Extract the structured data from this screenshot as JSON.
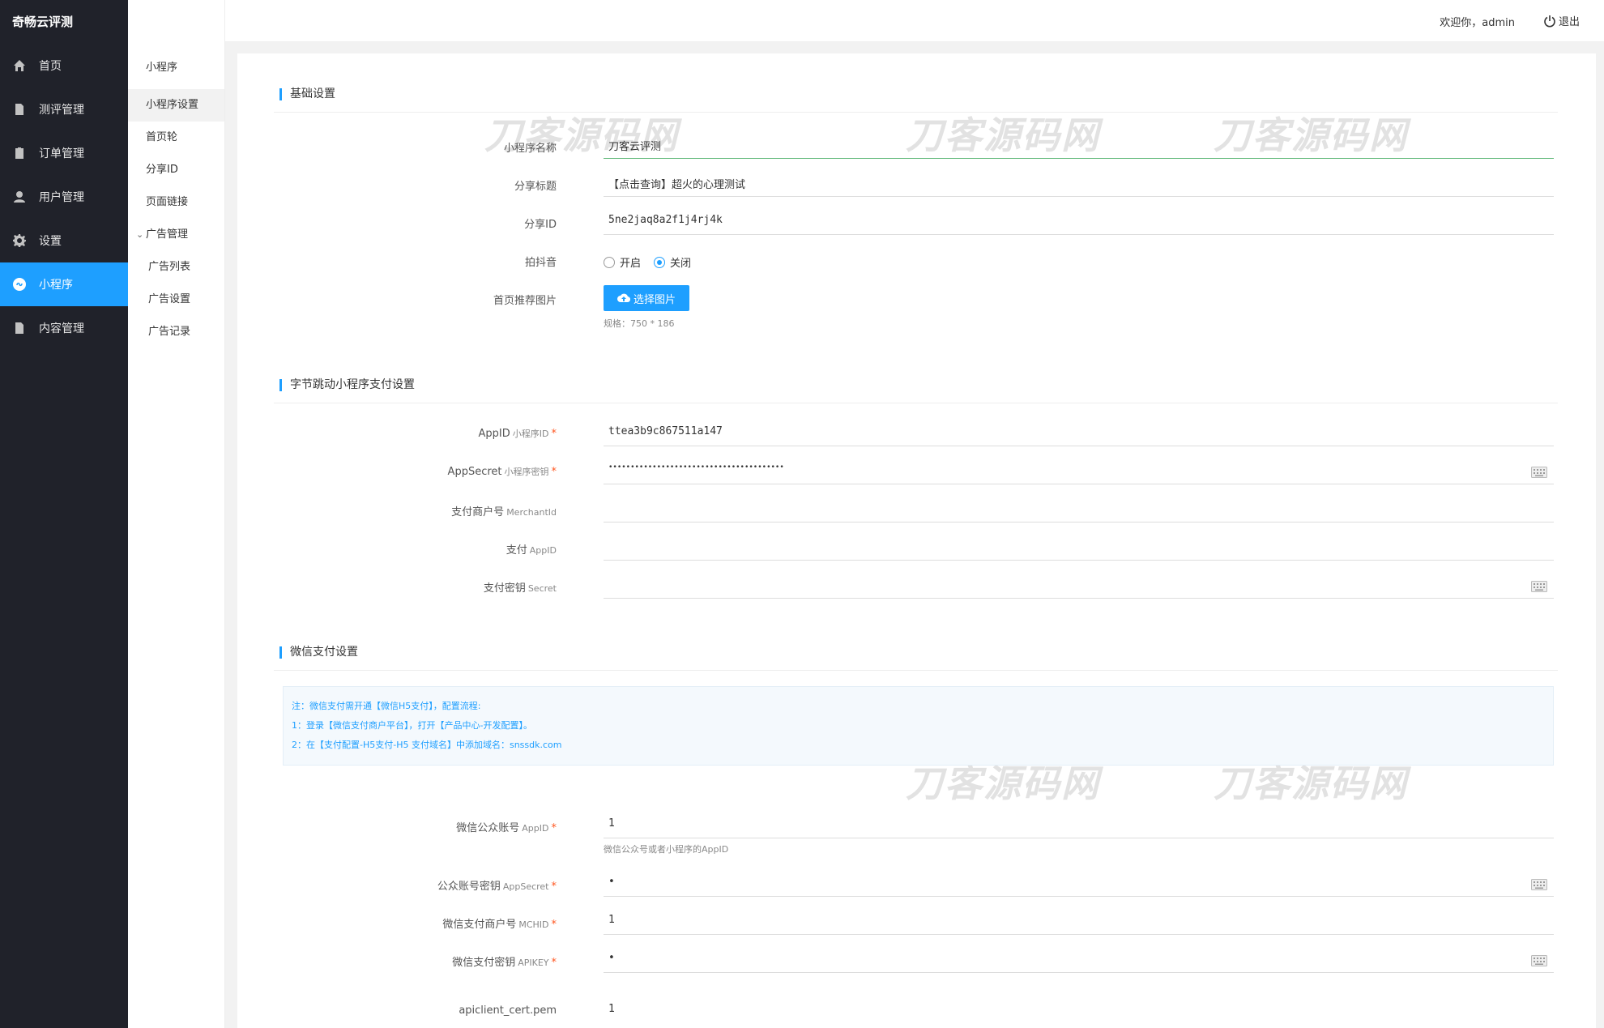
{
  "brand": "奇畅云评测",
  "nav": [
    {
      "label": "首页",
      "icon": "home-icon"
    },
    {
      "label": "测评管理",
      "icon": "document-icon"
    },
    {
      "label": "订单管理",
      "icon": "clipboard-icon"
    },
    {
      "label": "用户管理",
      "icon": "user-icon"
    },
    {
      "label": "设置",
      "icon": "gear-icon"
    },
    {
      "label": "小程序",
      "icon": "miniprogram-icon"
    },
    {
      "label": "内容管理",
      "icon": "document-icon"
    }
  ],
  "subnav": {
    "title": "小程序",
    "items": [
      "小程序设置",
      "首页轮",
      "分享ID",
      "页面链接"
    ],
    "group": "广告管理",
    "children": [
      "广告列表",
      "广告设置",
      "广告记录"
    ]
  },
  "header": {
    "welcome": "欢迎你，admin",
    "logout": "退出"
  },
  "watermark": "刀客源码网",
  "sections": {
    "basic": "基础设置",
    "bytedance": "字节跳动小程序支付设置",
    "wechat": "微信支付设置"
  },
  "basic": {
    "name_label": "小程序名称",
    "name_value": "刀客云评测",
    "share_title_label": "分享标题",
    "share_title_value": "【点击查询】超火的心理测试",
    "share_id_label": "分享ID",
    "share_id_value": "5ne2jaq8a2f1j4rj4k",
    "douyin_label": "拍抖音",
    "douyin_on": "开启",
    "douyin_off": "关闭",
    "douyin_selected": "关闭",
    "image_label": "首页推荐图片",
    "image_button": "选择图片",
    "image_hint": "规格：750 * 186"
  },
  "bytedance": {
    "appid_label": "AppID",
    "appid_sub": "小程序ID",
    "appid_value": "ttea3b9c867511a147",
    "secret_label": "AppSecret",
    "secret_sub": "小程序密钥",
    "secret_value": "••••••••••••••••••••••••••••••••••••••••",
    "merchant_label": "支付商户号",
    "merchant_sub": "MerchantId",
    "merchant_value": "",
    "pay_appid_label": "支付",
    "pay_appid_sub": "AppID",
    "pay_appid_value": "",
    "pay_secret_label": "支付密钥",
    "pay_secret_sub": "Secret",
    "pay_secret_value": ""
  },
  "notice": {
    "line1": "注：微信支付需开通【微信H5支付】，配置流程:",
    "line2": "1：登录【微信支付商户平台】，打开【产品中心-开发配置】。",
    "line3": "2：在【支付配置-H5支付-H5 支付域名】中添加域名：snssdk.com"
  },
  "wechat": {
    "appid_label": "微信公众账号",
    "appid_sub": "AppID",
    "appid_value": "1",
    "appid_hint": "微信公众号或者小程序的AppID",
    "secret_label": "公众账号密钥",
    "secret_sub": "AppSecret",
    "secret_value": "•",
    "mchid_label": "微信支付商户号",
    "mchid_sub": "MCHID",
    "mchid_value": "1",
    "apikey_label": "微信支付密钥",
    "apikey_sub": "APIKEY",
    "apikey_value": "•",
    "cert_label": "apiclient_cert.pem",
    "cert_value": "1"
  },
  "colors": {
    "accent": "#1e9fff",
    "sidebar": "#20222a",
    "required": "#ff5722"
  }
}
